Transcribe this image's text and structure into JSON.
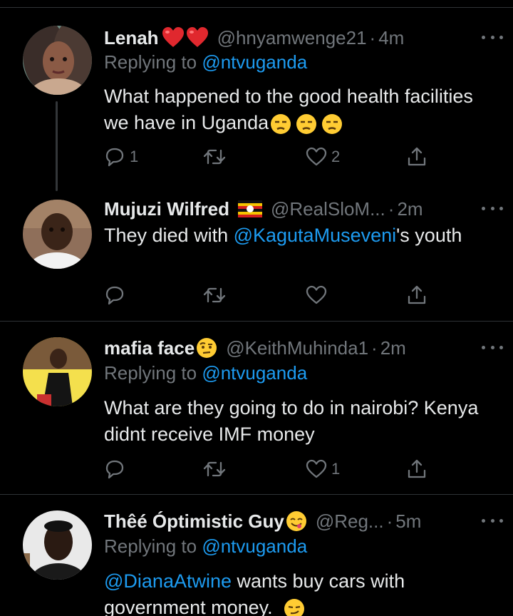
{
  "tweets": [
    {
      "name": "Lenah",
      "name_emoji": [
        "red-heart-emoji",
        "red-heart-emoji"
      ],
      "handle": "@hnyamwenge21",
      "time": "4m",
      "replying_prefix": "Replying to ",
      "replying_to": "@ntvuganda",
      "body": "What happened to the good health facilities we have in Uganda",
      "body_emoji": [
        "unamused-face-emoji",
        "unamused-face-emoji",
        "unamused-face-emoji"
      ],
      "reply_count": "1",
      "retweet_count": "",
      "like_count": "2"
    },
    {
      "name": "Mujuzi Wilfred",
      "name_emoji": [
        "uganda-flag-emoji"
      ],
      "handle": "@RealSloM...",
      "time": "2m",
      "body_pre": "They died with ",
      "body_mention": "@KagutaMuseveni",
      "body_post": "'s youth",
      "reply_count": "",
      "retweet_count": "",
      "like_count": ""
    },
    {
      "name": "mafia face",
      "name_emoji": [
        "face-with-raised-eyebrow-emoji"
      ],
      "handle": "@KeithMuhinda1",
      "time": "2m",
      "replying_prefix": "Replying to ",
      "replying_to": "@ntvuganda",
      "body": "What are they going to do in nairobi? Kenya didnt receive IMF money",
      "reply_count": "",
      "retweet_count": "",
      "like_count": "1"
    },
    {
      "name": "Thêé Óptimistic Guy",
      "name_emoji": [
        "face-savoring-food-emoji"
      ],
      "handle": "@Reg...",
      "time": "5m",
      "replying_prefix": "Replying to ",
      "replying_to": "@ntvuganda",
      "body_mention": "@DianaAtwine",
      "body_post": " wants buy cars with government money.",
      "body_emoji": [
        "smirking-face-emoji"
      ]
    }
  ],
  "colors": {
    "background": "#000000",
    "text": "#e7e9ea",
    "muted": "#71767b",
    "link": "#1d9bf0",
    "divider": "#2f3336"
  }
}
